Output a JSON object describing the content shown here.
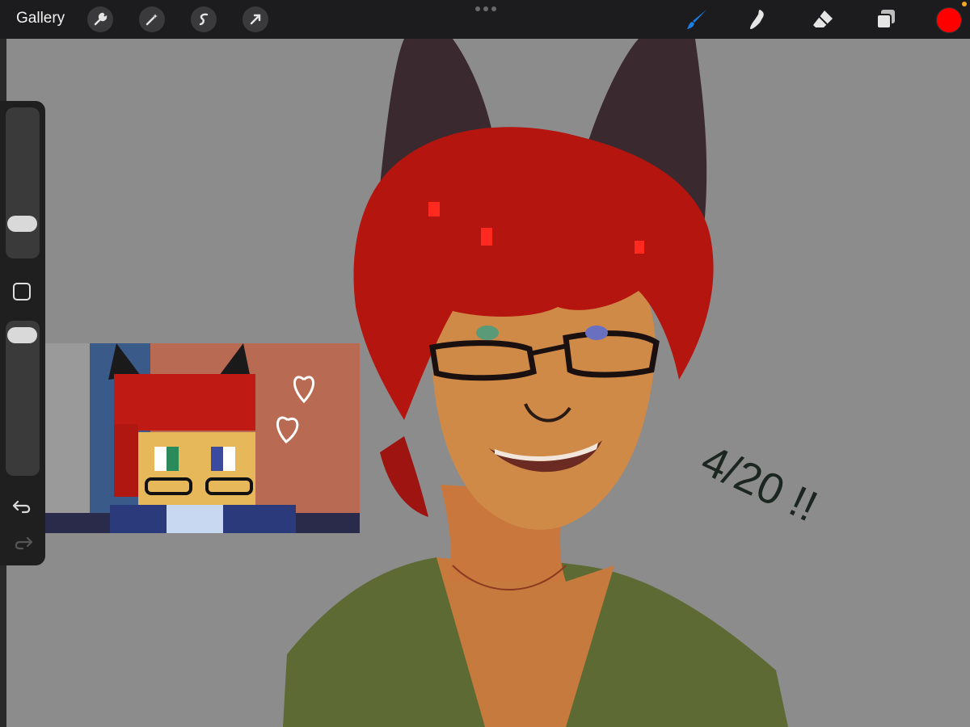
{
  "toolbar": {
    "gallery_label": "Gallery",
    "left_tools": [
      "wrench-icon",
      "magic-wand-icon",
      "selection-icon",
      "transform-arrow-icon"
    ],
    "right_tools": [
      "brush-icon",
      "smudge-icon",
      "eraser-icon",
      "layers-icon"
    ],
    "active_tool": "brush-icon",
    "current_color": "#ff0000",
    "accent_color": "#1a7fe8",
    "notification_color": "#f5a623"
  },
  "sidebar": {
    "brush_size_icon": "slider",
    "opacity_icon": "slider",
    "modifier_icon": "square-modifier-icon",
    "undo_icon": "undo-icon",
    "redo_icon": "redo-icon"
  },
  "canvas": {
    "background_color": "#8c8c8c",
    "date_note": "4/20 !!"
  }
}
